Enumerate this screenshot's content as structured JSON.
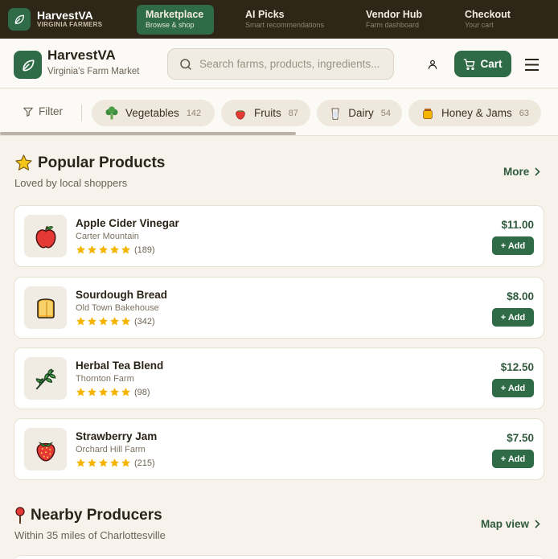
{
  "topbar": {
    "brand_name": "HarvestVA",
    "brand_sub": "VIRGINIA FARMERS",
    "tabs": [
      {
        "title": "Marketplace",
        "sub": "Browse & shop",
        "active": true
      },
      {
        "title": "AI Picks",
        "sub": "Smart recommendations",
        "active": false
      },
      {
        "title": "Vendor Hub",
        "sub": "Farm dashboard",
        "active": false
      },
      {
        "title": "Checkout",
        "sub": "Your cart",
        "active": false
      }
    ]
  },
  "header": {
    "title": "HarvestVA",
    "subtitle": "Virginia's Farm Market",
    "search_placeholder": "Search farms, products, ingredients...",
    "search_value": "",
    "cart_label": "Cart"
  },
  "filters": {
    "filter_label": "Filter",
    "chips": [
      {
        "label": "Vegetables",
        "count": "142",
        "icon": "broccoli-icon"
      },
      {
        "label": "Fruits",
        "count": "87",
        "icon": "strawberry-icon"
      },
      {
        "label": "Dairy",
        "count": "54",
        "icon": "milk-icon"
      },
      {
        "label": "Honey & Jams",
        "count": "63",
        "icon": "honey-pot-icon"
      }
    ]
  },
  "popular": {
    "title": "Popular Products",
    "subtitle": "Loved by local shoppers",
    "link": "More",
    "products": [
      {
        "name": "Apple Cider Vinegar",
        "vendor": "Carter Mountain",
        "rating": 5,
        "reviews": "(189)",
        "price": "$11.00",
        "add_label": "+ Add",
        "icon": "apple-icon"
      },
      {
        "name": "Sourdough Bread",
        "vendor": "Old Town Bakehouse",
        "rating": 5,
        "reviews": "(342)",
        "price": "$8.00",
        "add_label": "+ Add",
        "icon": "bread-icon"
      },
      {
        "name": "Herbal Tea Blend",
        "vendor": "Thornton Farm",
        "rating": 5,
        "reviews": "(98)",
        "price": "$12.50",
        "add_label": "+ Add",
        "icon": "herb-icon"
      },
      {
        "name": "Strawberry Jam",
        "vendor": "Orchard Hill Farm",
        "rating": 5,
        "reviews": "(215)",
        "price": "$7.50",
        "add_label": "+ Add",
        "icon": "strawberry-icon"
      }
    ]
  },
  "nearby": {
    "title": "Nearby Producers",
    "subtitle": "Within 35 miles of Charlottesville",
    "link": "Map view"
  },
  "colors": {
    "accent_green": "#2f6b46",
    "dark_bar": "#2e2616",
    "star": "#f5b400",
    "background": "#f7f3ec"
  }
}
